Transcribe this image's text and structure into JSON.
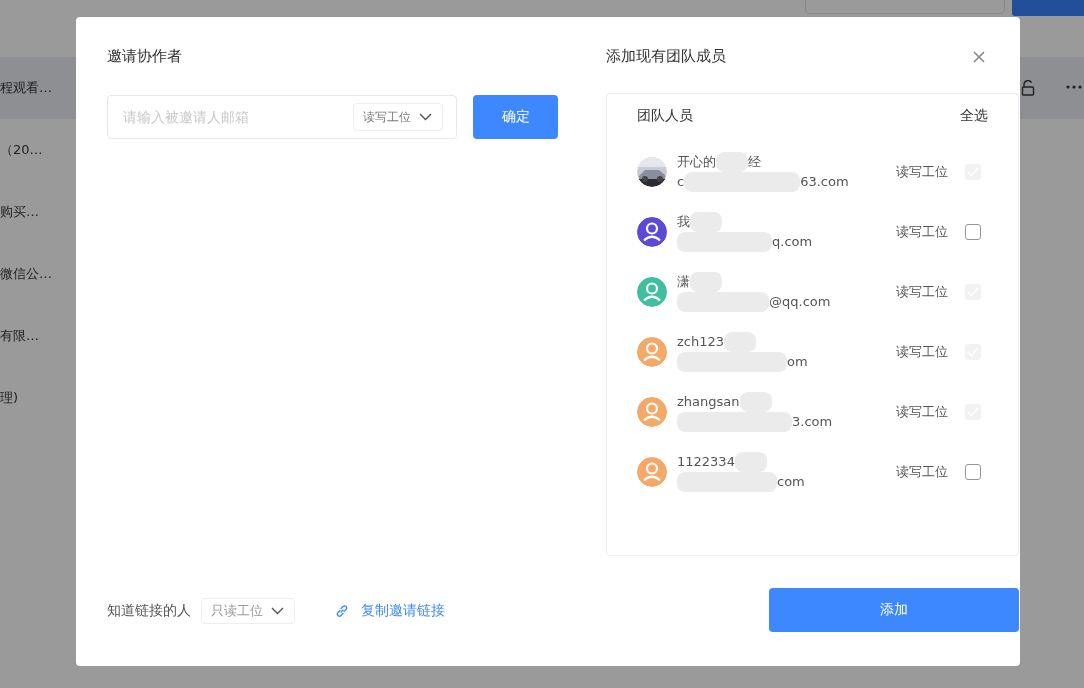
{
  "background": {
    "rows": [
      {
        "text": "程观看…",
        "selected": true
      },
      {
        "text": "（20…",
        "selected": false
      },
      {
        "text": "购买…",
        "selected": false
      },
      {
        "text": "微信公…",
        "selected": false
      },
      {
        "text": "有限…",
        "selected": false
      },
      {
        "text": "理)",
        "selected": false
      }
    ]
  },
  "invite": {
    "title": "邀请协作者",
    "email_placeholder": "请输入被邀请人邮箱",
    "role": "读写工位",
    "confirm": "确定",
    "link_label": "知道链接的人",
    "link_role": "只读工位",
    "copy_link": "复制邀请链接"
  },
  "team": {
    "title": "添加现有团队成员",
    "header_members": "团队人员",
    "select_all": "全选",
    "add": "添加",
    "members": [
      {
        "name": "开心的",
        "name_tail": "经",
        "email_head": "c",
        "email": "63.com",
        "role": "读写工位",
        "checked": true,
        "disabled": true
      },
      {
        "avatar": {
          "kind": "icon",
          "color": "#5b4ad8"
        },
        "name": "我",
        "email": "q.com",
        "role": "读写工位",
        "checked": false,
        "disabled": false
      },
      {
        "avatar": {
          "kind": "icon",
          "color": "#3fbf9f"
        },
        "name": "潇",
        "email": "@qq.com",
        "role": "读写工位",
        "checked": true,
        "disabled": true
      },
      {
        "avatar": {
          "kind": "icon",
          "color": "#f5a868"
        },
        "name": "zch123",
        "email": "om",
        "role": "读写工位",
        "checked": true,
        "disabled": true
      },
      {
        "avatar": {
          "kind": "icon",
          "color": "#f5a868"
        },
        "name": "zhangsan",
        "email": "3.com",
        "role": "读写工位",
        "checked": true,
        "disabled": true
      },
      {
        "avatar": {
          "kind": "icon",
          "color": "#f5a868"
        },
        "name": "1122334",
        "email": "com",
        "role": "读写工位",
        "checked": false,
        "disabled": false
      }
    ]
  }
}
